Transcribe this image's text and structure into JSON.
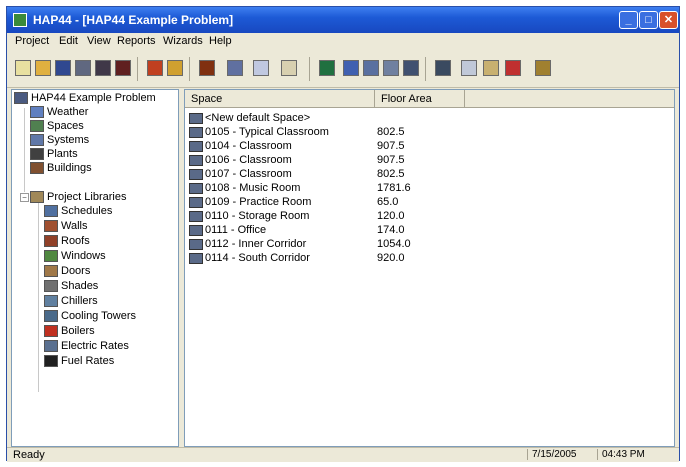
{
  "window": {
    "title": "HAP44 - [HAP44 Example Problem]",
    "buttons": {
      "minimize": "_",
      "maximize": "□",
      "close": "✕"
    }
  },
  "menu": {
    "items": [
      "Project",
      "Edit",
      "View",
      "Reports",
      "Wizards",
      "Help"
    ]
  },
  "toolbar": {
    "icons": [
      {
        "name": "new-icon",
        "color": "#e8e0a0"
      },
      {
        "name": "open-icon",
        "color": "#e0b040"
      },
      {
        "name": "save-icon",
        "color": "#304890"
      },
      {
        "name": "print-icon",
        "color": "#606880"
      },
      {
        "name": "archive-icon",
        "color": "#403848"
      },
      {
        "name": "retrieve-icon",
        "color": "#602020"
      },
      {
        "name": "wizard-icon",
        "color": "#c04020"
      },
      {
        "name": "calculator-icon",
        "color": "#d0a030"
      },
      {
        "name": "book-icon",
        "color": "#803010"
      },
      {
        "name": "properties-icon",
        "color": "#6070a0"
      },
      {
        "name": "copy-icon",
        "color": "#c0c8e0"
      },
      {
        "name": "paste-icon",
        "color": "#d8d0b0"
      },
      {
        "name": "report-icon",
        "color": "#207040"
      },
      {
        "name": "chart-icon",
        "color": "#4060b0"
      },
      {
        "name": "tree-icon",
        "color": "#5a70a0"
      },
      {
        "name": "list-icon",
        "color": "#7080a0"
      },
      {
        "name": "details-icon",
        "color": "#405070"
      },
      {
        "name": "table-icon",
        "color": "#3a4a60"
      },
      {
        "name": "large-icons-icon",
        "color": "#c0c8d8"
      },
      {
        "name": "small-icons-icon",
        "color": "#c8b070"
      },
      {
        "name": "filter-icon",
        "color": "#c03030"
      },
      {
        "name": "funnel-icon",
        "color": "#a08030"
      }
    ]
  },
  "tree": {
    "root": "HAP44 Example Problem",
    "items": [
      {
        "label": "Weather",
        "color": "#6080c0",
        "level": 1
      },
      {
        "label": "Spaces",
        "color": "#508050",
        "level": 1
      },
      {
        "label": "Systems",
        "color": "#6078a8",
        "level": 1
      },
      {
        "label": "Plants",
        "color": "#404040",
        "level": 1
      },
      {
        "label": "Buildings",
        "color": "#805030",
        "level": 1
      },
      {
        "label": "Project Libraries",
        "color": "#a08858",
        "level": 1
      },
      {
        "label": "Schedules",
        "color": "#5070a0",
        "level": 2
      },
      {
        "label": "Walls",
        "color": "#a05030",
        "level": 2
      },
      {
        "label": "Roofs",
        "color": "#904028",
        "level": 2
      },
      {
        "label": "Windows",
        "color": "#508840",
        "level": 2
      },
      {
        "label": "Doors",
        "color": "#a07848",
        "level": 2
      },
      {
        "label": "Shades",
        "color": "#707070",
        "level": 2
      },
      {
        "label": "Chillers",
        "color": "#6080a0",
        "level": 2
      },
      {
        "label": "Cooling Towers",
        "color": "#4a6a8a",
        "level": 2
      },
      {
        "label": "Boilers",
        "color": "#c03020",
        "level": 2
      },
      {
        "label": "Electric Rates",
        "color": "#5a7090",
        "level": 2
      },
      {
        "label": "Fuel Rates",
        "color": "#202020",
        "level": 2
      }
    ]
  },
  "list": {
    "columns": [
      "Space",
      "Floor Area"
    ],
    "rows": [
      {
        "name": "<New default Space>",
        "area": ""
      },
      {
        "name": "0105 - Typical Classroom",
        "area": "802.5"
      },
      {
        "name": "0104 - Classroom",
        "area": "907.5"
      },
      {
        "name": "0106 - Classroom",
        "area": "907.5"
      },
      {
        "name": "0107 - Classroom",
        "area": "802.5"
      },
      {
        "name": "0108 - Music Room",
        "area": "1781.6"
      },
      {
        "name": "0109 - Practice Room",
        "area": "65.0"
      },
      {
        "name": "0110 - Storage Room",
        "area": "120.0"
      },
      {
        "name": "0111 - Office",
        "area": "174.0"
      },
      {
        "name": "0112 - Inner Corridor",
        "area": "1054.0"
      },
      {
        "name": "0114 - South Corridor",
        "area": "920.0"
      }
    ]
  },
  "status": {
    "text": "Ready",
    "date": "7/15/2005",
    "time": "04:43 PM"
  }
}
